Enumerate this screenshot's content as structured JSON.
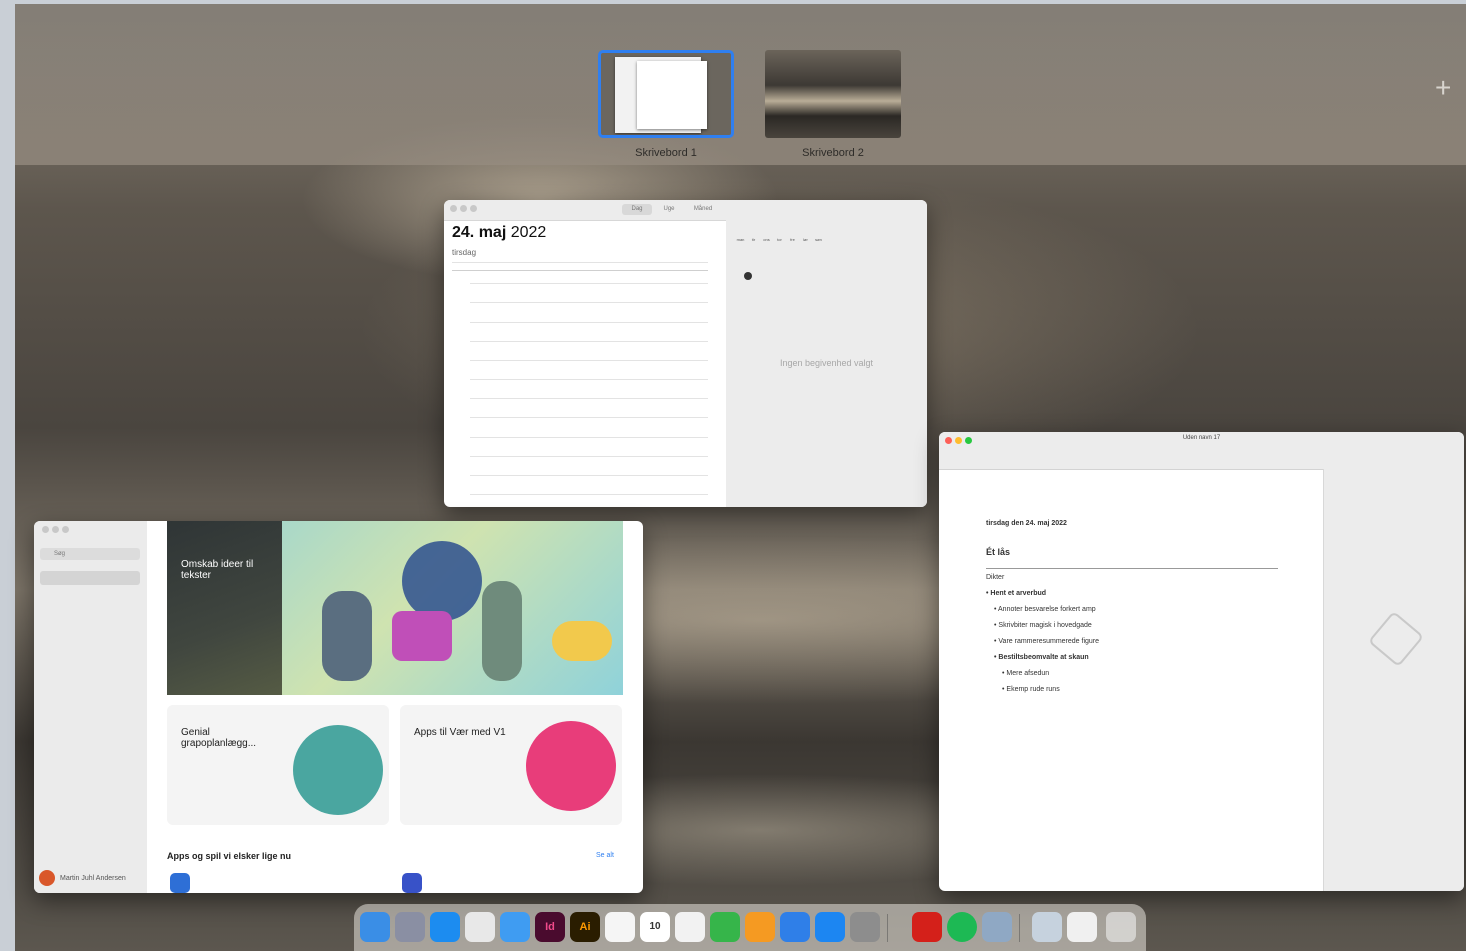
{
  "spaces": {
    "items": [
      {
        "label": "Skrivebord 1",
        "selected": true
      },
      {
        "label": "Skrivebord 2",
        "selected": false
      }
    ],
    "add_icon": "plus-icon"
  },
  "calendar": {
    "toolbar": {
      "day": "Dag",
      "week": "Uge",
      "month": "Måned"
    },
    "date_day": "24. maj",
    "date_year": "2022",
    "weekday": "tirsdag",
    "no_event_text": "Ingen begivenhed valgt",
    "mini_month_header": [
      "man",
      "tir",
      "ons",
      "tor",
      "fre",
      "lør",
      "søn"
    ],
    "today_color": "#333333"
  },
  "appstore": {
    "search_placeholder": "Søg",
    "hero_title": "Omskab ideer til tekster",
    "card1_title": "Genial grapoplanlægg...",
    "card2_title": "Apps til Vær med V1",
    "section_title": "Apps og spil vi elsker lige nu",
    "see_all": "Se alt",
    "user": "Martin Juhl Andersen",
    "accent": "#2f7ff0"
  },
  "pages": {
    "title": "Uden navn 17",
    "doc_date": "tirsdag den 24. maj 2022",
    "doc_heading": "Ét lås",
    "doc_lines": [
      "Dikter",
      "• Hent et arverbud",
      "• Annoter besvarelse forkert amp",
      "• Skrivbiter magisk i hovedgade",
      "• Vare rammeresummerede figure",
      "• Bestiltsbeomvalte at skaun",
      "• Mere afsedun",
      "• Ekemp rude runs"
    ]
  },
  "dock": {
    "icons": [
      "finder-icon",
      "launchpad-icon",
      "safari-icon",
      "chrome-icon",
      "mail-icon",
      "indesign-icon",
      "illustrator-icon",
      "photos-icon",
      "calendar-icon",
      "reminders-icon",
      "numbers-icon",
      "pages-icon",
      "keynote-icon",
      "appstore-icon",
      "settings-icon",
      "acrobat-icon",
      "spotify-icon",
      "preview-icon",
      "downloads-icon",
      "documents-icon",
      "trash-icon"
    ],
    "calendar_day": "10"
  }
}
